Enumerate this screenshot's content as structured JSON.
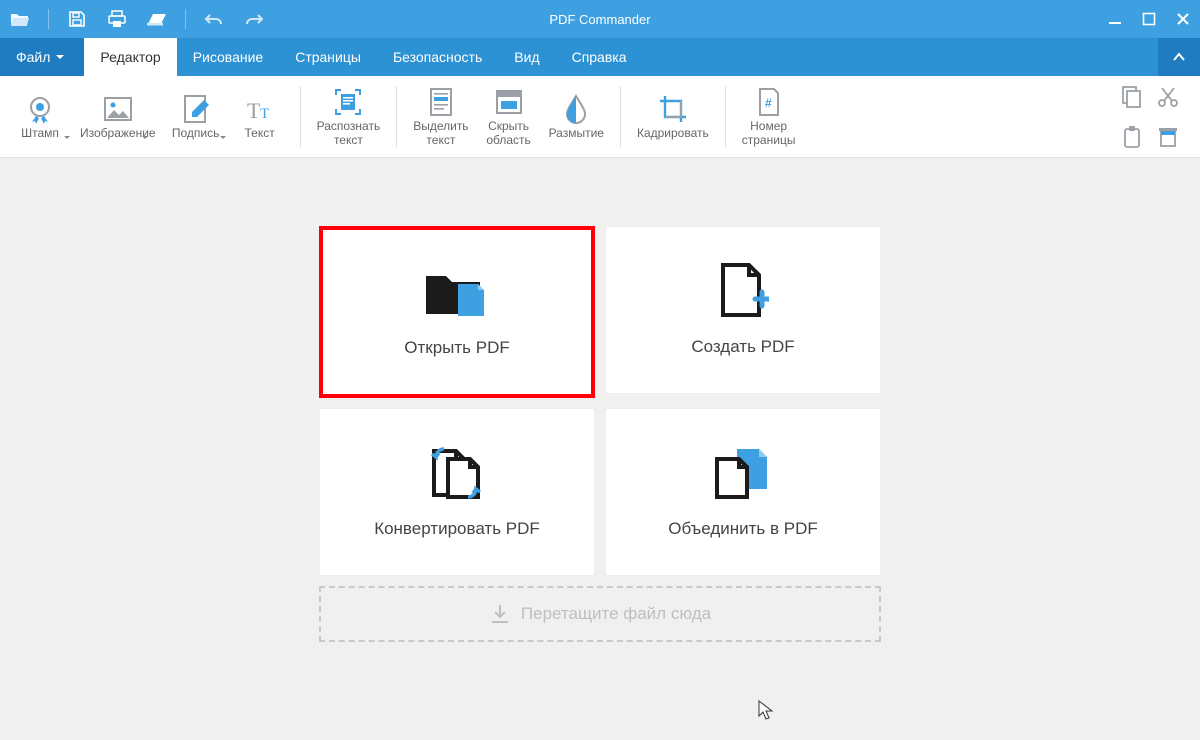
{
  "app": {
    "title": "PDF Commander"
  },
  "menu": {
    "file": "Файл",
    "items": [
      "Редактор",
      "Рисование",
      "Страницы",
      "Безопасность",
      "Вид",
      "Справка"
    ]
  },
  "ribbon": {
    "stamp": "Штамп",
    "image": "Изображение",
    "signature": "Подпись",
    "text": "Текст",
    "ocr_line1": "Распознать",
    "ocr_line2": "текст",
    "highlight_line1": "Выделить",
    "highlight_line2": "текст",
    "hide_line1": "Скрыть",
    "hide_line2": "область",
    "blur": "Размытие",
    "crop": "Кадрировать",
    "pagenum_line1": "Номер",
    "pagenum_line2": "страницы"
  },
  "cards": {
    "open": "Открыть PDF",
    "create": "Создать PDF",
    "convert": "Конвертировать PDF",
    "merge": "Объединить в PDF"
  },
  "dropzone": {
    "label": "Перетащите файл сюда"
  },
  "colors": {
    "accent": "#2d92d4",
    "accent_light": "#3ea0e0",
    "highlight": "#ff0008",
    "icon_blue": "#2f95d8",
    "text_muted": "#777"
  }
}
